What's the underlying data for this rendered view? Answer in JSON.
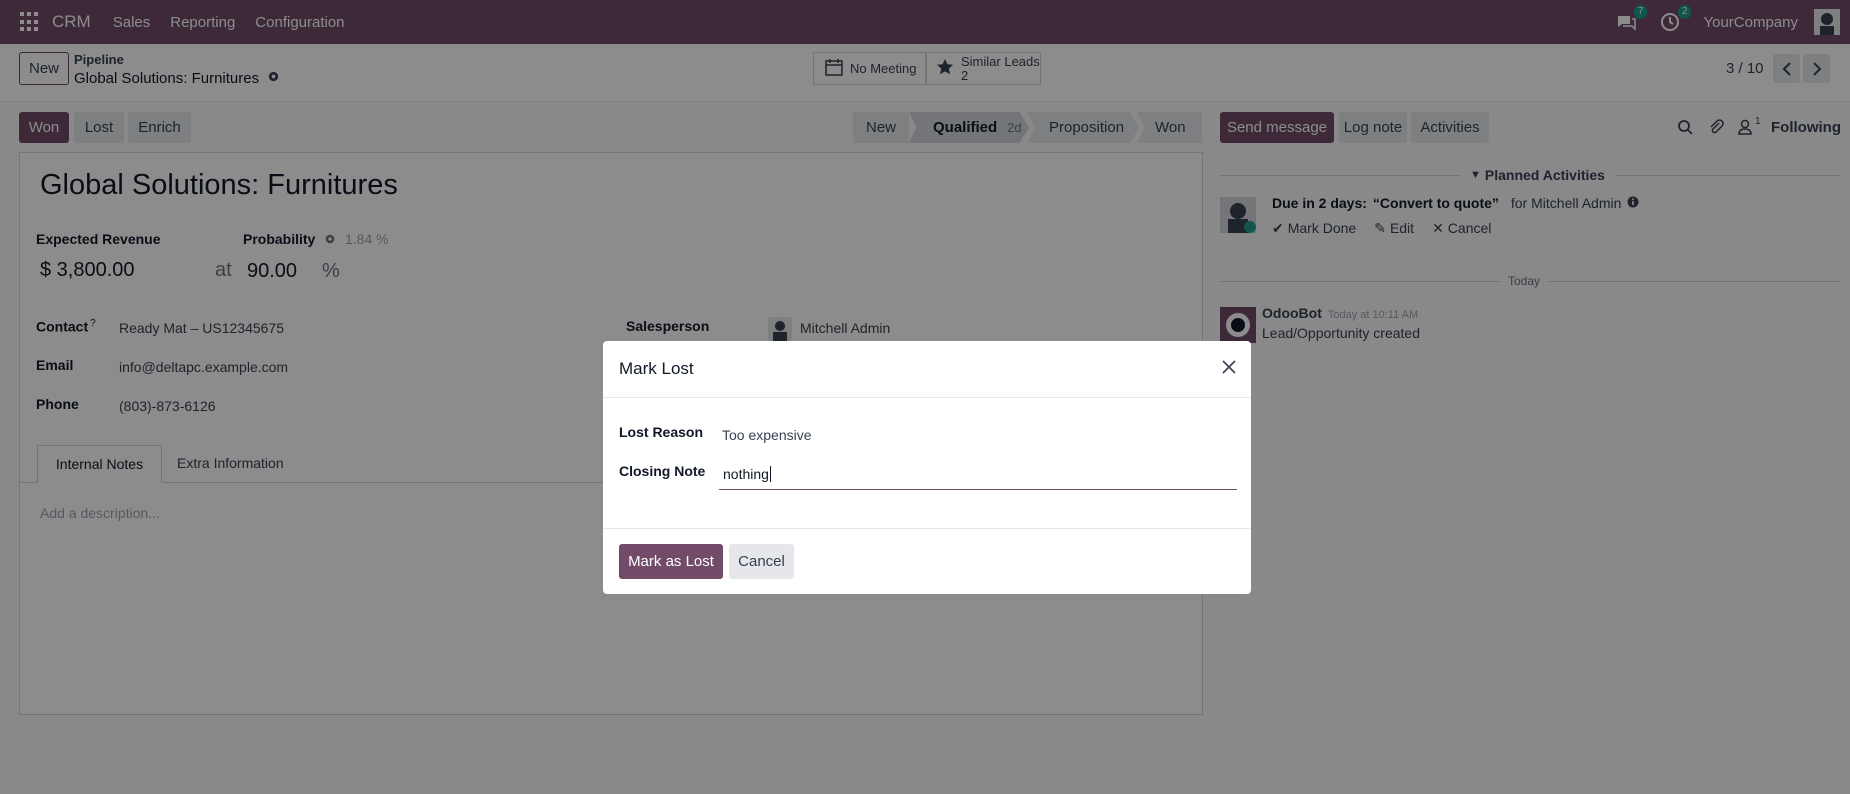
{
  "navbar": {
    "brand": "CRM",
    "menus": [
      "Sales",
      "Reporting",
      "Configuration"
    ],
    "messages_count": "7",
    "activities_count": "2",
    "company": "YourCompany"
  },
  "control_panel": {
    "new_label": "New",
    "breadcrumb_parent": "Pipeline",
    "breadcrumb_current": "Global Solutions: Furnitures",
    "meeting_label": "No Meeting",
    "similar_label": "Similar Leads",
    "similar_count": "2",
    "pager": "3 / 10"
  },
  "actions": {
    "won": "Won",
    "lost": "Lost",
    "enrich": "Enrich"
  },
  "stages": [
    {
      "label": "New",
      "active": false
    },
    {
      "label": "Qualified",
      "active": true,
      "duration": "2d"
    },
    {
      "label": "Proposition",
      "active": false
    },
    {
      "label": "Won",
      "active": false
    }
  ],
  "record": {
    "title": "Global Solutions: Furnitures",
    "expected_revenue_label": "Expected Revenue",
    "probability_label": "Probability",
    "probability_auto": "1.84 %",
    "revenue": "$ 3,800.00",
    "at": "at",
    "probability": "90.00",
    "percent": "%",
    "contact_label": "Contact",
    "contact_help": "?",
    "contact": "Ready Mat – US12345675",
    "email_label": "Email",
    "email": "info@deltapc.example.com",
    "phone_label": "Phone",
    "phone": "(803)-873-6126",
    "salesperson_label": "Salesperson",
    "salesperson": "Mitchell Admin",
    "tabs": [
      "Internal Notes",
      "Extra Information"
    ],
    "description_placeholder": "Add a description..."
  },
  "chatter": {
    "send_message": "Send message",
    "log_note": "Log note",
    "activities": "Activities",
    "followers_count": "1",
    "following": "Following",
    "planned_title": "Planned Activities",
    "due": "Due in 2 days:",
    "activity_name": "“Convert to quote”",
    "for_user": "for Mitchell Admin",
    "mark_done": "Mark Done",
    "edit": "Edit",
    "cancel": "Cancel",
    "today": "Today",
    "bot_name": "OdooBot",
    "bot_time": "Today at 10:11 AM",
    "bot_message": "Lead/Opportunity created"
  },
  "dialog": {
    "title": "Mark Lost",
    "lost_reason_label": "Lost Reason",
    "lost_reason": "Too expensive",
    "closing_note_label": "Closing Note",
    "closing_note": "nothing",
    "confirm": "Mark as Lost",
    "cancel": "Cancel"
  }
}
